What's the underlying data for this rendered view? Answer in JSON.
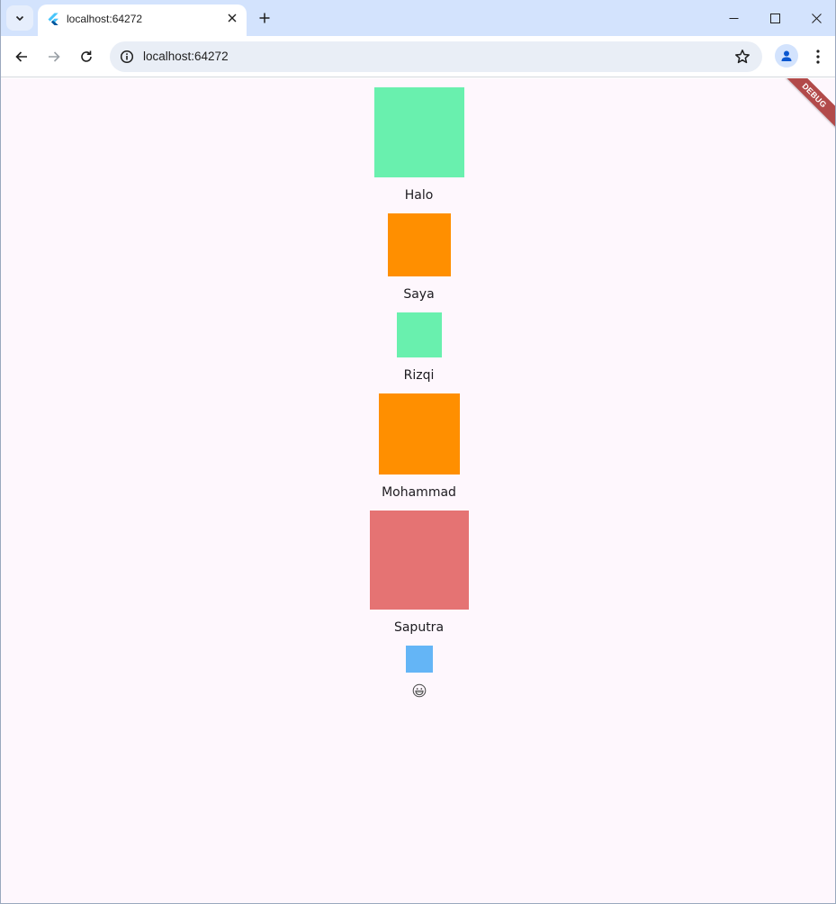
{
  "browser": {
    "tab_title": "localhost:64272",
    "url": "localhost:64272"
  },
  "app": {
    "debug_banner": "DEBUG",
    "items": [
      {
        "label": "Halo",
        "color": "#69f0ae"
      },
      {
        "label": "Saya",
        "color": "#ff8f00"
      },
      {
        "label": "Rizqi",
        "color": "#69f0ae"
      },
      {
        "label": "Mohammad",
        "color": "#ff8f00"
      },
      {
        "label": "Saputra",
        "color": "#e57373"
      },
      {
        "label": "",
        "color": "#64b5f6",
        "icon": "grinning-face-icon"
      }
    ]
  },
  "icons": {
    "tab_search": "chevron-down-icon",
    "favicon": "flutter-logo-icon",
    "tab_close": "close-icon",
    "new_tab": "plus-icon",
    "minimize": "minimize-icon",
    "maximize": "maximize-icon",
    "close": "close-icon",
    "back": "arrow-left-icon",
    "forward": "arrow-right-icon",
    "reload": "reload-icon",
    "site_info": "info-icon",
    "bookmark": "star-icon",
    "profile": "person-icon",
    "menu": "kebab-menu-icon"
  }
}
